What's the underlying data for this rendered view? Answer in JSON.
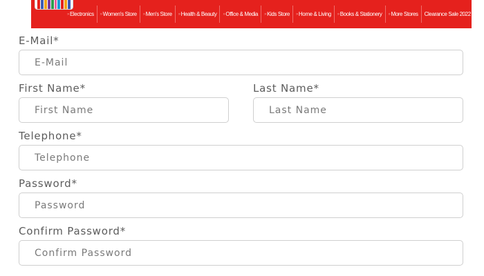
{
  "nav": {
    "items": [
      {
        "label": "Electronics"
      },
      {
        "label": "Women's Store"
      },
      {
        "label": "Men's Store"
      },
      {
        "label": "Health & Beauty"
      },
      {
        "label": "Office & Media"
      },
      {
        "label": "Kids Store"
      },
      {
        "label": "Home & Living"
      },
      {
        "label": "Books & Stationery"
      },
      {
        "label": "More Stores"
      },
      {
        "label": "Clearance Sale 2022"
      }
    ],
    "arrow_glyph": "»"
  },
  "form": {
    "email": {
      "label": "E-Mail*",
      "placeholder": "E-Mail",
      "value": ""
    },
    "first_name": {
      "label": "First Name*",
      "placeholder": "First Name",
      "value": ""
    },
    "last_name": {
      "label": "Last Name*",
      "placeholder": "Last Name",
      "value": ""
    },
    "telephone": {
      "label": "Telephone*",
      "placeholder": "Telephone",
      "value": ""
    },
    "password": {
      "label": "Password*",
      "placeholder": "Password",
      "value": ""
    },
    "confirm_password": {
      "label": "Confirm Password*",
      "placeholder": "Confirm Password",
      "value": ""
    }
  },
  "colors": {
    "accent": "#e5211d",
    "label_text": "#5c5c5c",
    "field_border": "#cfcfcf"
  },
  "logo_colors": [
    "#e5211d",
    "#3b5bb5",
    "#f2a31b",
    "#7c3a9e",
    "#2e9e4f",
    "#e55fa0",
    "#1a9ad6",
    "#e5211d",
    "#f2a31b",
    "#3b5bb5"
  ]
}
